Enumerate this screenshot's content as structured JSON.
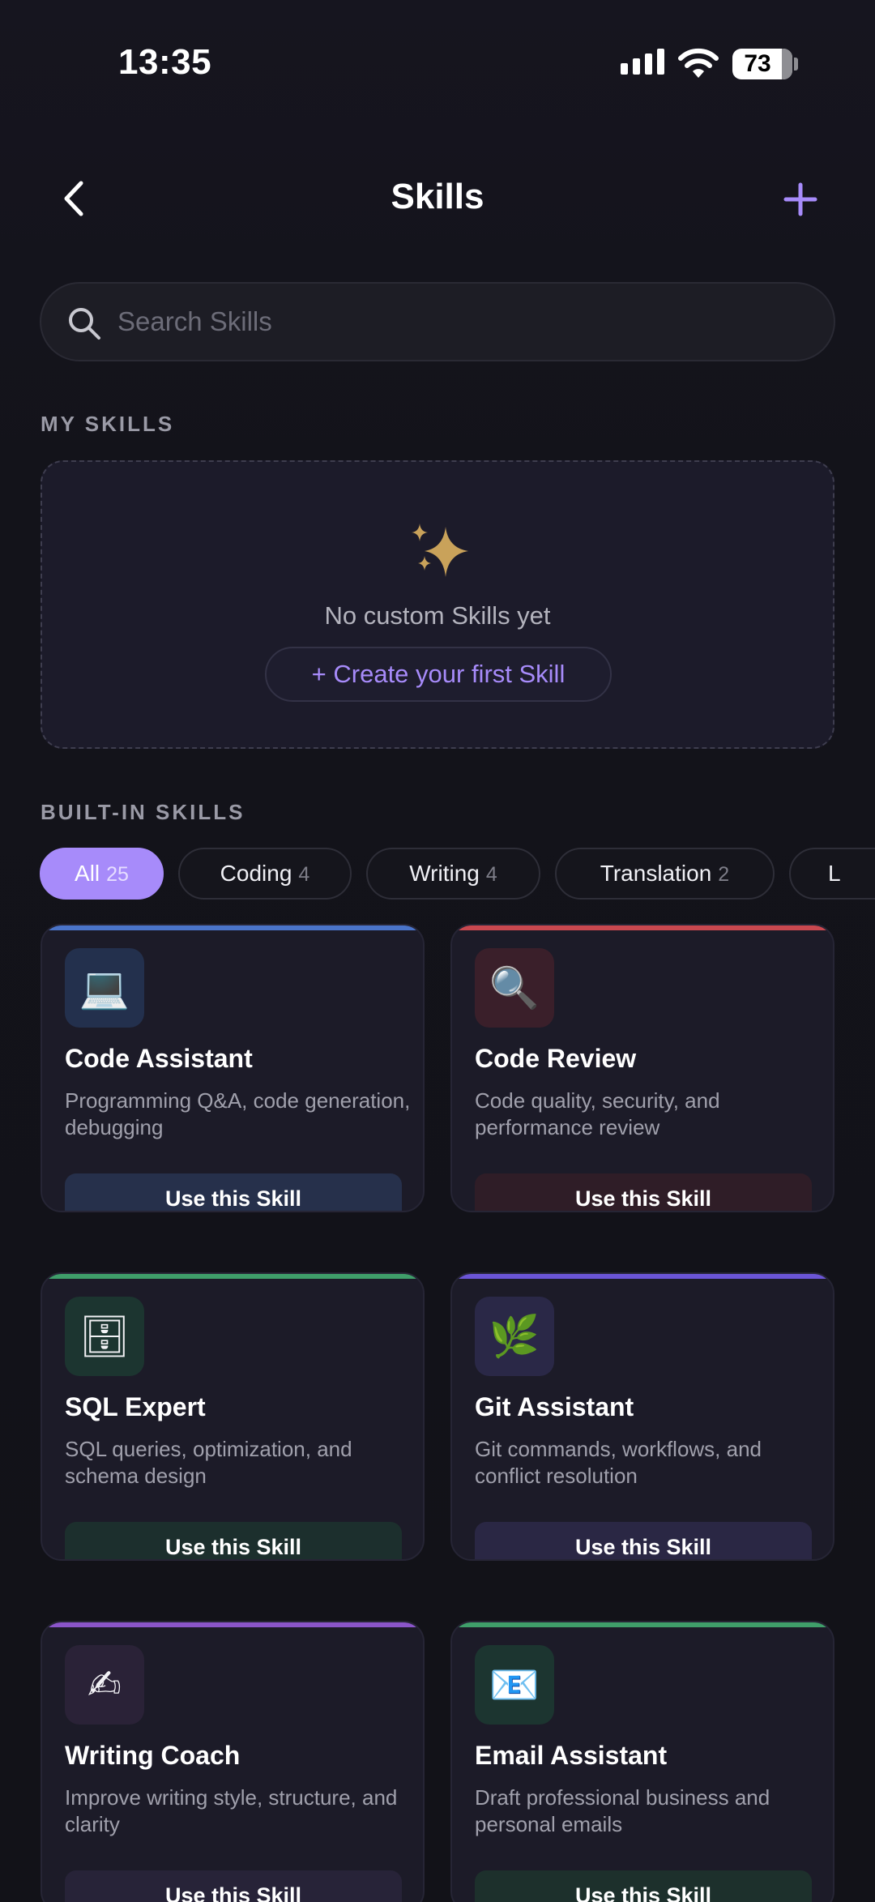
{
  "status_bar": {
    "time": "13:35",
    "battery": "73"
  },
  "nav": {
    "title": "Skills",
    "back_icon": "chevron-left-icon",
    "add_icon": "plus-icon"
  },
  "search": {
    "placeholder": "Search Skills",
    "value": ""
  },
  "my_skills": {
    "label": "MY SKILLS",
    "empty_text": "No custom Skills yet",
    "create_label": "+ Create your first Skill",
    "icon": "sparkles-icon"
  },
  "built_in": {
    "label": "BUILT-IN SKILLS",
    "filters": [
      {
        "label": "All",
        "count": "25",
        "active": true
      },
      {
        "label": "Coding",
        "count": "4"
      },
      {
        "label": "Writing",
        "count": "4"
      },
      {
        "label": "Translation",
        "count": "2"
      },
      {
        "label": "L",
        "count": ""
      }
    ],
    "skills": [
      {
        "title": "Code Assistant",
        "desc": "Programming Q&A, code generation, debugging",
        "button": "Use this Skill",
        "emoji": "💻",
        "accent": "#4a74c9",
        "icon_bg": "#23304d",
        "btn_bg": "#26304b"
      },
      {
        "title": "Code Review",
        "desc": "Code quality, security, and performance review",
        "button": "Use this Skill",
        "emoji": "🔍",
        "accent": "#c9484f",
        "icon_bg": "#3a1f2a",
        "btn_bg": "#2f1d27"
      },
      {
        "title": "SQL Expert",
        "desc": "SQL queries, optimization, and schema design",
        "button": "Use this Skill",
        "emoji": "🗄",
        "accent": "#3f9e6a",
        "icon_bg": "#1c3530",
        "btn_bg": "#1c2f2d"
      },
      {
        "title": "Git Assistant",
        "desc": "Git commands, workflows, and conflict resolution",
        "button": "Use this Skill",
        "emoji": "🌿",
        "accent": "#6b55d6",
        "icon_bg": "#2a2847",
        "btn_bg": "#2a2744"
      },
      {
        "title": "Writing Coach",
        "desc": "Improve writing style, structure, and clarity",
        "button": "Use this Skill",
        "emoji": "✍",
        "accent": "#8a55c9",
        "icon_bg": "#2a2237",
        "btn_bg": "#272338"
      },
      {
        "title": "Email Assistant",
        "desc": "Draft professional business and personal emails",
        "button": "Use this Skill",
        "emoji": "📧",
        "accent": "#3f9e6a",
        "icon_bg": "#1c3530",
        "btn_bg": "#1d302c"
      }
    ]
  }
}
